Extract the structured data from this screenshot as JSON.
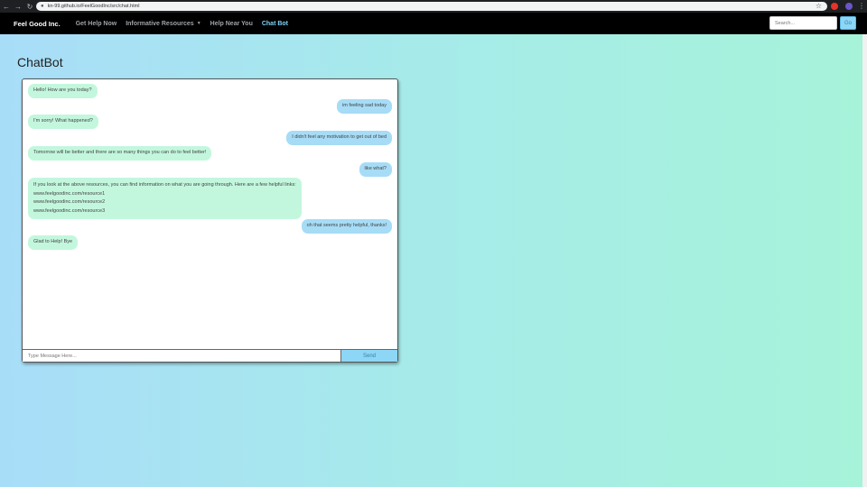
{
  "browser": {
    "url": "kn-99.github.io/FeelGoodInc/src/chat.html"
  },
  "navbar": {
    "brand": "Feel Good Inc.",
    "links": [
      "Get Help Now",
      "Informative Resources",
      "Help Near You",
      "Chat Bot"
    ],
    "active_index": 3,
    "search_placeholder": "Search...",
    "go_label": "Go"
  },
  "page": {
    "title": "ChatBot"
  },
  "chat": {
    "messages": [
      {
        "from": "bot",
        "text": "Hello! How are you today?"
      },
      {
        "from": "user",
        "text": "im feeling sad today"
      },
      {
        "from": "bot",
        "text": "I'm sorry! What happened?"
      },
      {
        "from": "user",
        "text": "I didn't feel any motivation to get out of bed"
      },
      {
        "from": "bot",
        "text": "Tomorrow will be better and there are so many things you can do to feel better!"
      },
      {
        "from": "user",
        "text": "like what?"
      },
      {
        "from": "bot",
        "text": "If you look at the above resources, you can find information on what you are going through. Here are a few helpful links:",
        "links": [
          "www.feelgoodinc.com/resource1",
          "www.feelgoodinc.com/resource2",
          "www.feelgoodinc.com/resource3"
        ]
      },
      {
        "from": "user",
        "text": "oh that seems pretty helpful, thanks!"
      },
      {
        "from": "bot",
        "text": "Glad to Help! Bye"
      }
    ],
    "input_placeholder": "Type Message Here...",
    "send_label": "Send"
  },
  "colors": {
    "bot_bubble": "#c3f7dd",
    "user_bubble": "#a6dcf6",
    "active_link": "#7fd3f7",
    "navbar_bg": "#000000"
  }
}
